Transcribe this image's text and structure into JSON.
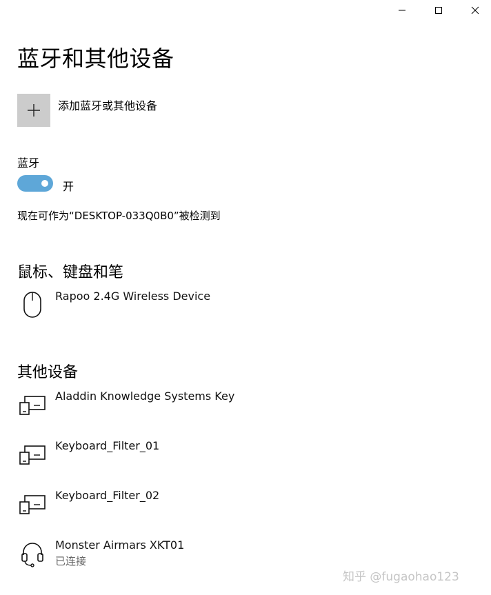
{
  "window": {
    "minimize": "minimize-icon",
    "maximize": "maximize-icon",
    "close": "close-icon"
  },
  "title": "蓝牙和其他设备",
  "add_device": {
    "label": "添加蓝牙或其他设备",
    "icon": "plus-icon"
  },
  "bluetooth": {
    "label": "蓝牙",
    "toggle_on": true,
    "toggle_state": "开",
    "discoverable_text": "现在可作为“DESKTOP-033Q0B0”被检测到",
    "accent_color": "#5ea7d8"
  },
  "mouse_section": {
    "title": "鼠标、键盘和笔",
    "devices": [
      {
        "name": "Rapoo 2.4G Wireless Device",
        "icon": "mouse-icon"
      }
    ]
  },
  "other_section": {
    "title": "其他设备",
    "devices": [
      {
        "name": "Aladdin Knowledge Systems Key",
        "icon": "device-icon"
      },
      {
        "name": "Keyboard_Filter_01",
        "icon": "device-icon"
      },
      {
        "name": "Keyboard_Filter_02",
        "icon": "device-icon"
      },
      {
        "name": "Monster Airmars XKT01",
        "status": "已连接",
        "icon": "headset-icon"
      }
    ]
  },
  "watermark": "知乎 @fugaohao123"
}
